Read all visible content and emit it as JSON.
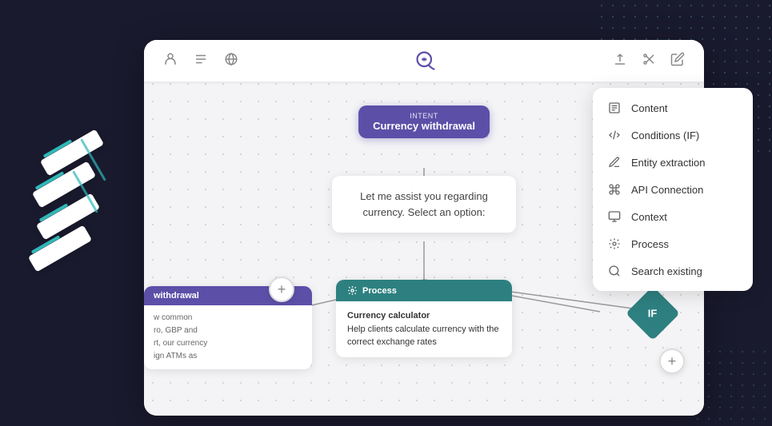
{
  "toolbar": {
    "left_icons": [
      "user-icon",
      "list-icon",
      "globe-icon"
    ],
    "right_icons": [
      "upload-icon",
      "scissors-icon",
      "edit-icon"
    ]
  },
  "intent_node": {
    "label": "Intent",
    "title": "Currency withdrawal"
  },
  "content_box": {
    "text": "Let me assist you regarding currency. Select an option:"
  },
  "left_card": {
    "header": "withdrawal",
    "body": "w common\nro, GBP and\nrt, our currency\nign ATMs as"
  },
  "center_card": {
    "header": "Process",
    "title": "Currency calculator",
    "description": "Help clients calculate currency with the correct exchange rates"
  },
  "if_node": {
    "label": "IF"
  },
  "plus_buttons": {
    "left_label": "+",
    "right_label": "+"
  },
  "context_menu": {
    "items": [
      {
        "icon": "content-icon",
        "label": "Content"
      },
      {
        "icon": "conditions-icon",
        "label": "Conditions (IF)"
      },
      {
        "icon": "entity-icon",
        "label": "Entity extraction"
      },
      {
        "icon": "api-icon",
        "label": "API Connection"
      },
      {
        "icon": "context-icon",
        "label": "Context"
      },
      {
        "icon": "process-icon",
        "label": "Process"
      },
      {
        "icon": "search-icon",
        "label": "Search existing"
      }
    ]
  },
  "colors": {
    "primary": "#5b4fa8",
    "teal": "#2e8080",
    "bg_canvas": "#f4f4f6",
    "white": "#ffffff",
    "text_dark": "#333333",
    "text_muted": "#666666"
  }
}
